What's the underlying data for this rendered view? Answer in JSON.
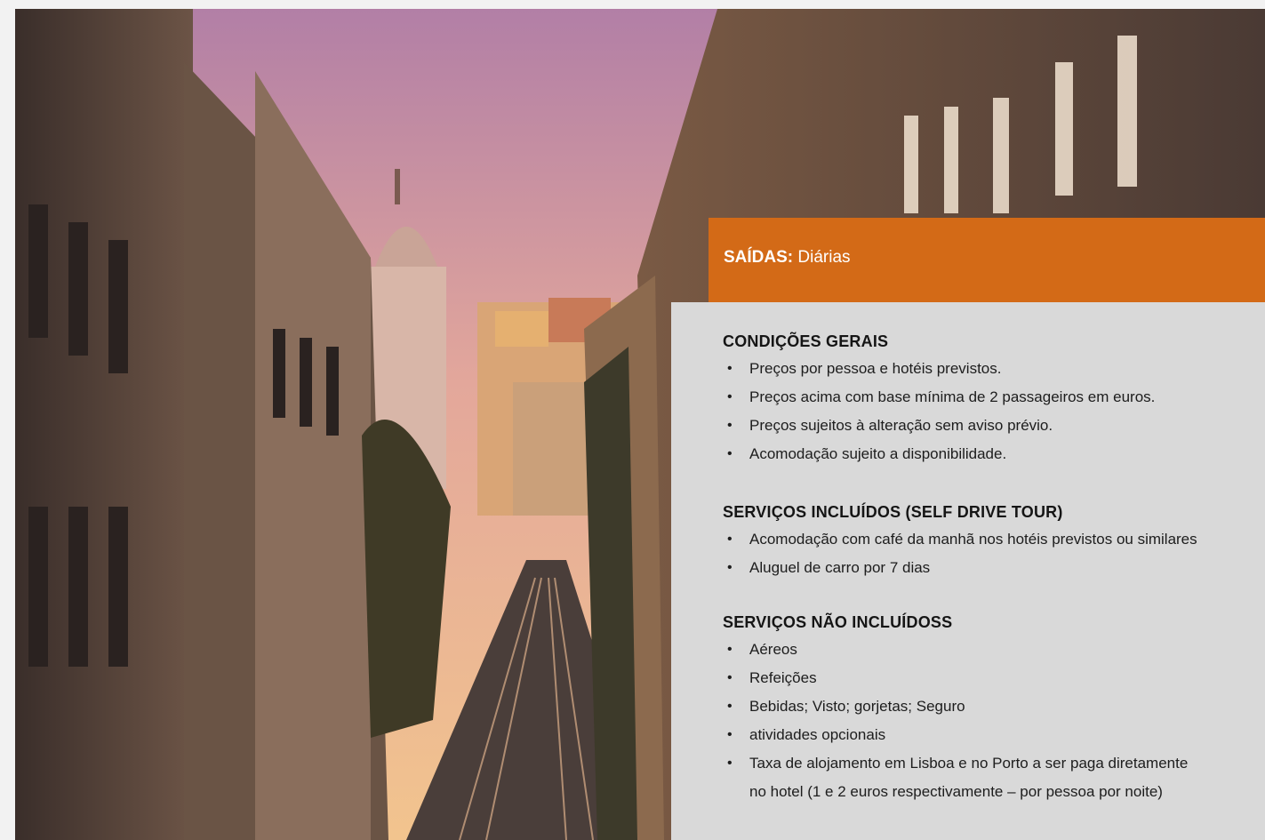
{
  "departures": {
    "label": "SAÍDAS:",
    "value": "Diárias"
  },
  "general_conditions": {
    "title": "CONDIÇÕES GERAIS",
    "items": [
      "Preços por pessoa e hotéis previstos.",
      "Preços acima com base mínima de 2 passageiros em euros.",
      "Preços sujeitos à alteração sem aviso prévio.",
      "Acomodação sujeito a disponibilidade."
    ]
  },
  "included_services": {
    "title": "SERVIÇOS INCLUÍDOS (SELF DRIVE TOUR)",
    "items": [
      "Acomodação com café da manhã nos hotéis previstos ou similares",
      "Aluguel de carro por 7 dias"
    ]
  },
  "not_included_services": {
    "title": "SERVIÇOS NÃO INCLUÍDOSS",
    "items": [
      "Aéreos",
      "Refeições",
      "Bebidas; Visto; gorjetas; Seguro",
      "atividades opcionais",
      "Taxa de alojamento em Lisboa e no Porto a ser paga diretamente",
      "no hotel (1 e 2 euros respectivamente – por pessoa por noite)"
    ]
  },
  "colors": {
    "accent": "#d36a17",
    "panel": "#d9d9d9"
  }
}
